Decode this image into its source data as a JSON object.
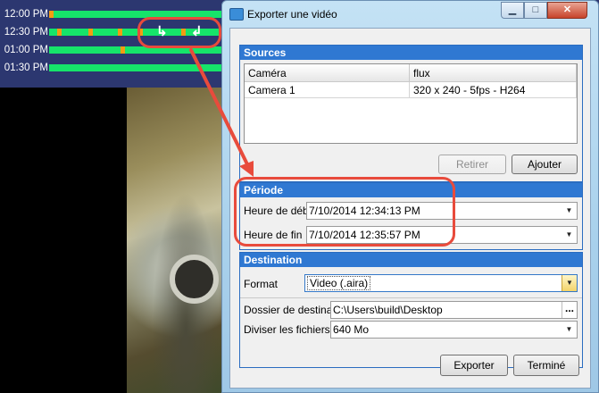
{
  "timeline": {
    "rows": [
      {
        "time": "12:00 PM"
      },
      {
        "time": "12:30 PM"
      },
      {
        "time": "01:00 PM"
      },
      {
        "time": "01:30 PM"
      }
    ],
    "start_marker_icon": "start-bracket-icon",
    "end_marker_icon": "end-bracket-icon"
  },
  "dialog": {
    "title": "Exporter une vidéo",
    "caption_buttons": {
      "minimize": "▁",
      "maximize": "□",
      "close": "✕"
    },
    "sources": {
      "header": "Sources",
      "columns": [
        "Caméra",
        "flux"
      ],
      "rows": [
        {
          "camera": "Camera 1",
          "flux": "320 x 240 - 5fps - H264"
        }
      ],
      "remove_label": "Retirer",
      "add_label": "Ajouter"
    },
    "periode": {
      "header": "Période",
      "start_label": "Heure de début",
      "start_value": "7/10/2014 12:34:13 PM",
      "end_label": "Heure de fin",
      "end_value": "7/10/2014 12:35:57 PM"
    },
    "destination": {
      "header": "Destination",
      "format_label": "Format",
      "format_value": "Video (.aira)",
      "folder_label": "Dossier de destination",
      "folder_value": "C:\\Users\\build\\Desktop",
      "browse_label": "...",
      "split_label": "Diviser les fichiers à",
      "split_value": "640 Mo"
    },
    "export_label": "Exporter",
    "done_label": "Terminé"
  },
  "colors": {
    "timeline_bg": "#2c3770",
    "timeline_bar": "#16e46a",
    "timeline_mark": "#f39c12",
    "group_header": "#2f78d2",
    "annotation": "#e84b3c"
  }
}
